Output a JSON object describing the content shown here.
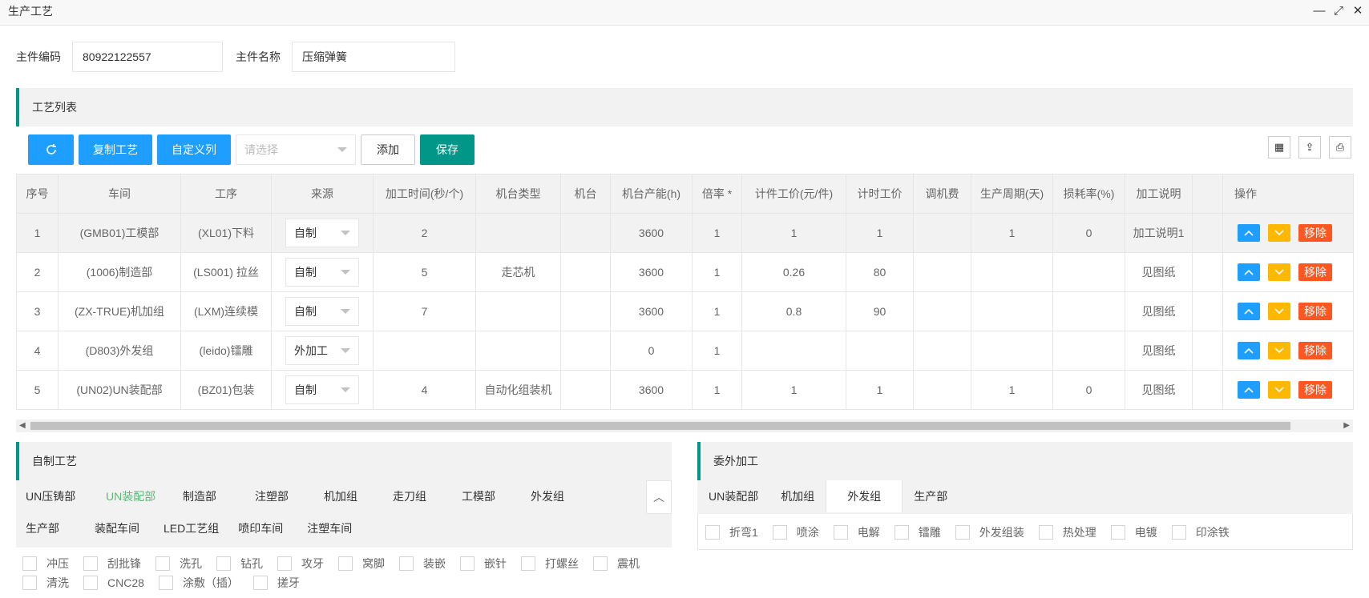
{
  "window": {
    "title": "生产工艺"
  },
  "header": {
    "code_label": "主件编码",
    "code_value": "80922122557",
    "name_label": "主件名称",
    "name_value": "压缩弹簧"
  },
  "process_panel": {
    "title": "工艺列表"
  },
  "toolbar": {
    "copy_label": "复制工艺",
    "custom_label": "自定义列",
    "select_placeholder": "请选择",
    "add_label": "添加",
    "save_label": "保存"
  },
  "table": {
    "headers": [
      "序号",
      "车间",
      "工序",
      "来源",
      "加工时间(秒/个)",
      "机台类型",
      "机台",
      "机台产能(h)",
      "倍率 *",
      "计件工价(元/件)",
      "计时工价",
      "调机费",
      "生产周期(天)",
      "损耗率(%)",
      "加工说明",
      "",
      "操作"
    ],
    "rows": [
      {
        "no": "1",
        "workshop": "(GMB01)工模部",
        "process": "(XL01)下料",
        "source": "自制",
        "time": "2",
        "machine_type": "",
        "machine": "",
        "capacity": "3600",
        "rate": "1",
        "piece_price": "1",
        "time_price": "1",
        "setup_fee": "",
        "cycle": "1",
        "loss": "0",
        "note": "加工说明1"
      },
      {
        "no": "2",
        "workshop": "(1006)制造部",
        "process": "(LS001) 拉丝",
        "source": "自制",
        "time": "5",
        "machine_type": "走芯机",
        "machine": "",
        "capacity": "3600",
        "rate": "1",
        "piece_price": "0.26",
        "time_price": "80",
        "setup_fee": "",
        "cycle": "",
        "loss": "",
        "note": "见图纸"
      },
      {
        "no": "3",
        "workshop": "(ZX-TRUE)机加组",
        "process": "(LXM)连续模",
        "source": "自制",
        "time": "7",
        "machine_type": "",
        "machine": "",
        "capacity": "3600",
        "rate": "1",
        "piece_price": "0.8",
        "time_price": "90",
        "setup_fee": "",
        "cycle": "",
        "loss": "",
        "note": "见图纸"
      },
      {
        "no": "4",
        "workshop": "(D803)外发组",
        "process": "(leido)镭雕",
        "source": "外加工",
        "time": "",
        "machine_type": "",
        "machine": "",
        "capacity": "0",
        "rate": "1",
        "piece_price": "",
        "time_price": "",
        "setup_fee": "",
        "cycle": "",
        "loss": "",
        "note": "见图纸"
      },
      {
        "no": "5",
        "workshop": "(UN02)UN装配部",
        "process": "(BZ01)包装",
        "source": "自制",
        "time": "4",
        "machine_type": "自动化组装机",
        "machine": "",
        "capacity": "3600",
        "rate": "1",
        "piece_price": "1",
        "time_price": "1",
        "setup_fee": "",
        "cycle": "1",
        "loss": "0",
        "note": "见图纸"
      }
    ],
    "op_up": "^",
    "op_down": "v",
    "op_remove": "移除"
  },
  "self_panel": {
    "title": "自制工艺",
    "tabs": [
      "UN压铸部",
      "UN装配部",
      "制造部",
      "注塑部",
      "机加组",
      "走刀组",
      "工模部",
      "外发组",
      "生产部",
      "装配车间",
      "LED工艺组",
      "喷印车间",
      "注塑车间"
    ],
    "active_tab": "UN装配部",
    "options": [
      "冲压",
      "刮批锋",
      "洗孔",
      "钻孔",
      "攻牙",
      "窝脚",
      "装嵌",
      "嵌针",
      "打螺丝",
      "震机",
      "清洗",
      "CNC28",
      "涂敷（插）",
      "搓牙"
    ]
  },
  "outsource_panel": {
    "title": "委外加工",
    "tabs": [
      "UN装配部",
      "机加组",
      "外发组",
      "生产部"
    ],
    "active_tab": "外发组",
    "options": [
      "折弯1",
      "喷涂",
      "电解",
      "镭雕",
      "外发组装",
      "热处理",
      "电镀",
      "印涂铁"
    ]
  },
  "colors": {
    "accent": "#009688",
    "blue": "#1e9fff",
    "orange": "#ffb800",
    "red": "#ff5722",
    "tab_active_green": "#5fb878"
  }
}
